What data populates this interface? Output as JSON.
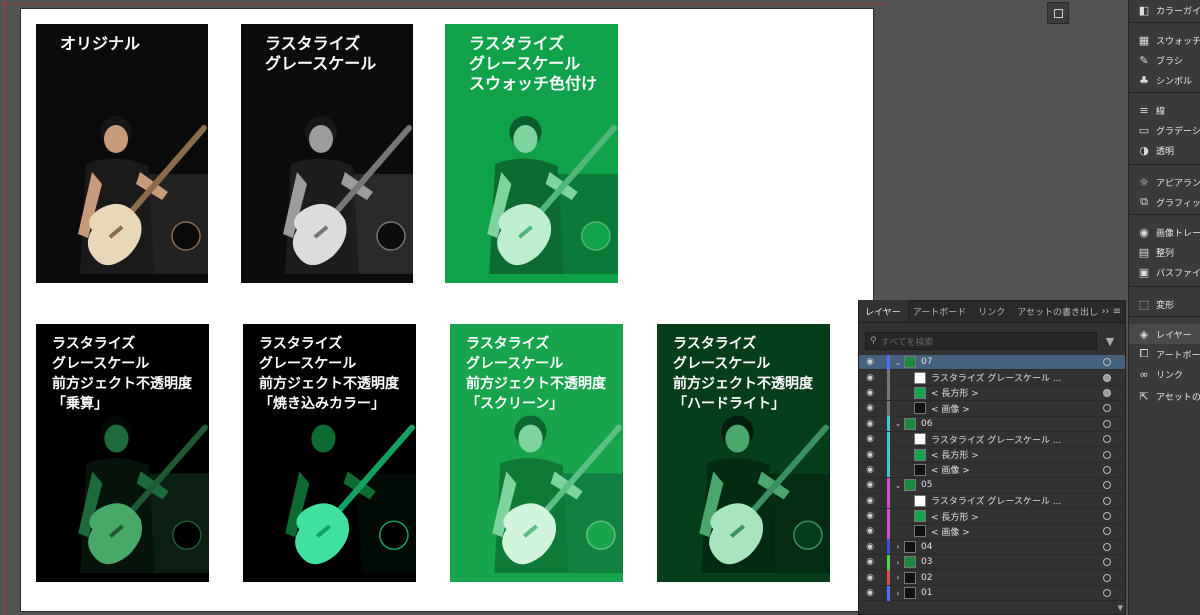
{
  "artboard": {
    "cards": [
      {
        "label": "オリジナル",
        "variant": "original"
      },
      {
        "label": "ラスタライズ\nグレースケール",
        "variant": "gray"
      },
      {
        "label": "ラスタライズ\nグレースケール\nスウォッチ色付け",
        "variant": "greenflat"
      },
      {
        "label": "ラスタライズ\nグレースケール\n前方ジェクト不透明度\n「乗算」",
        "variant": "multiply"
      },
      {
        "label": "ラスタライズ\nグレースケール\n前方ジェクト不透明度\n「焼き込みカラー」",
        "variant": "colorburn"
      },
      {
        "label": "ラスタライズ\nグレースケール\n前方ジェクト不透明度\n「スクリーン」",
        "variant": "screen"
      },
      {
        "label": "ラスタライズ\nグレースケール\n前方ジェクト不透明度\n「ハードライト」",
        "variant": "hardlight"
      }
    ]
  },
  "right_panel": {
    "items": [
      {
        "label": "カラーガイド",
        "icon": "color-guide-icon",
        "glyph": "◧"
      },
      {
        "label": "スウォッチ",
        "icon": "swatches-icon",
        "glyph": "▦"
      },
      {
        "label": "ブラシ",
        "icon": "brushes-icon",
        "glyph": "✎"
      },
      {
        "label": "シンボル",
        "icon": "symbols-icon",
        "glyph": "♣"
      },
      {
        "label": "線",
        "icon": "stroke-icon",
        "glyph": "≡"
      },
      {
        "label": "グラデーション",
        "icon": "gradient-icon",
        "glyph": "▭"
      },
      {
        "label": "透明",
        "icon": "transparency-icon",
        "glyph": "◑"
      },
      {
        "label": "アピアランス",
        "icon": "appearance-icon",
        "glyph": "☼"
      },
      {
        "label": "グラフィックスタイル",
        "icon": "graphic-styles-icon",
        "glyph": "⧉"
      },
      {
        "label": "画像トレース",
        "icon": "image-trace-icon",
        "glyph": "◉"
      },
      {
        "label": "整列",
        "icon": "align-icon",
        "glyph": "▤"
      },
      {
        "label": "パスファインダー",
        "icon": "pathfinder-icon",
        "glyph": "▣"
      },
      {
        "label": "変形",
        "icon": "transform-icon",
        "glyph": "⬚"
      },
      {
        "label": "レイヤー",
        "icon": "layers-icon",
        "glyph": "◈"
      },
      {
        "label": "アートボード",
        "icon": "artboards-icon",
        "glyph": "⧠"
      },
      {
        "label": "リンク",
        "icon": "links-icon",
        "glyph": "∞"
      },
      {
        "label": "アセットの書き出し",
        "icon": "asset-export-icon",
        "glyph": "⇱"
      }
    ]
  },
  "layers_panel": {
    "tabs": [
      "レイヤー",
      "アートボード",
      "リンク",
      "アセットの書き出し"
    ],
    "menu_glyph": "›› ≡",
    "search_placeholder": "すべてを検索",
    "rows": [
      {
        "name": "07",
        "level": 0,
        "expanded": true,
        "color": "#4f6fff",
        "thumb": "#1a8a3e",
        "selected": true,
        "target_filled": false
      },
      {
        "name": "ラスタライズ グレースケール ...",
        "level": 1,
        "color": "#777777",
        "thumb": "#ffffff",
        "target_filled": true
      },
      {
        "name": "< 長方形 >",
        "level": 1,
        "color": "#777777",
        "thumb": "#18a44c",
        "target_filled": true
      },
      {
        "name": "< 画像 >",
        "level": 1,
        "color": "#777777",
        "thumb": "#111111",
        "target_filled": false
      },
      {
        "name": "06",
        "level": 0,
        "expanded": true,
        "color": "#3fc9d6",
        "thumb": "#1a8a3e",
        "target_filled": false
      },
      {
        "name": "ラスタライズ グレースケール ...",
        "level": 1,
        "color": "#3fc9d6",
        "thumb": "#ffffff",
        "target_filled": false
      },
      {
        "name": "< 長方形 >",
        "level": 1,
        "color": "#3fc9d6",
        "thumb": "#18a44c",
        "target_filled": false
      },
      {
        "name": "< 画像 >",
        "level": 1,
        "color": "#3fc9d6",
        "thumb": "#111111",
        "target_filled": false
      },
      {
        "name": "05",
        "level": 0,
        "expanded": true,
        "color": "#d64fd0",
        "thumb": "#1a8a3e",
        "target_filled": false
      },
      {
        "name": "ラスタライズ グレースケール ...",
        "level": 1,
        "color": "#d64fd0",
        "thumb": "#ffffff",
        "target_filled": false
      },
      {
        "name": "< 長方形 >",
        "level": 1,
        "color": "#d64fd0",
        "thumb": "#18a44c",
        "target_filled": false
      },
      {
        "name": "< 画像 >",
        "level": 1,
        "color": "#d64fd0",
        "thumb": "#111111",
        "target_filled": false
      },
      {
        "name": "04",
        "level": 0,
        "expanded": false,
        "color": "#3a4fd6",
        "thumb": "#111111",
        "target_filled": false
      },
      {
        "name": "03",
        "level": 0,
        "expanded": false,
        "color": "#4fd64f",
        "thumb": "#1a8a3e",
        "target_filled": false
      },
      {
        "name": "02",
        "level": 0,
        "expanded": false,
        "color": "#d64f4f",
        "thumb": "#111111",
        "target_filled": false
      },
      {
        "name": "01",
        "level": 0,
        "expanded": false,
        "color": "#4f6fff",
        "thumb": "#111111",
        "target_filled": false
      }
    ]
  },
  "colors": {
    "swatch_green": "#0fa24a",
    "dark_green": "#0a3a1a",
    "selection_blue": "#46617e"
  }
}
